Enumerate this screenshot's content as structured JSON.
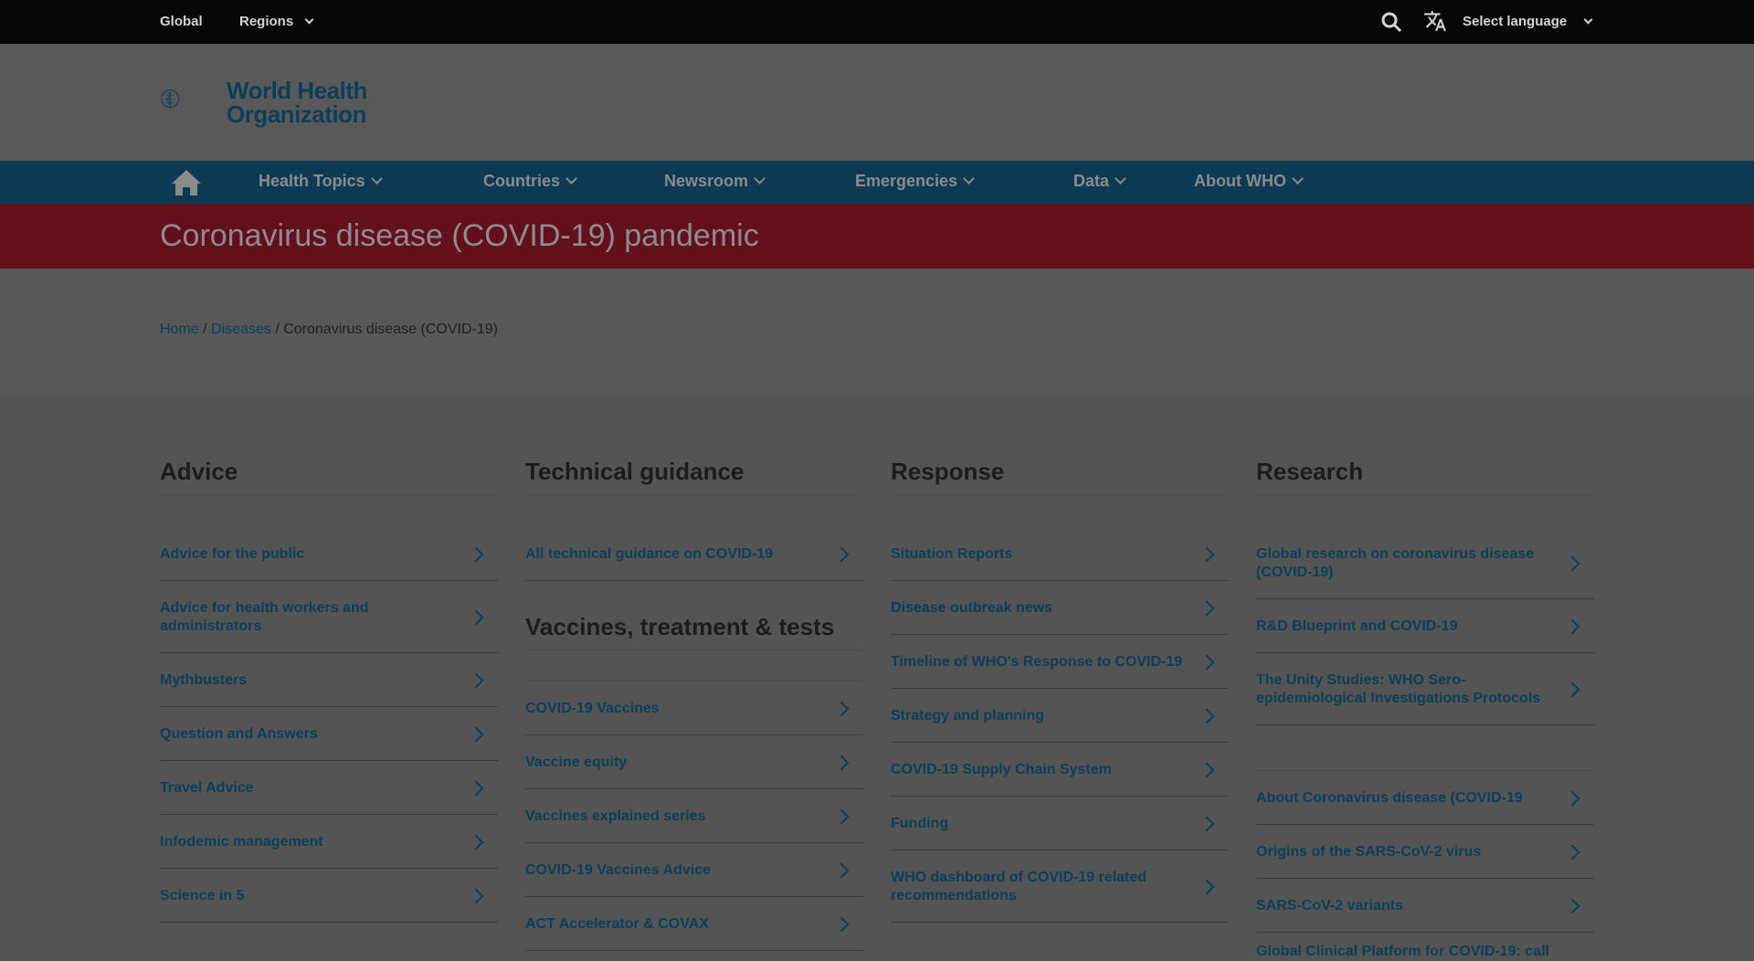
{
  "topbar": {
    "global": "Global",
    "regions": "Regions",
    "select_language": "Select language"
  },
  "logo": {
    "line1": "World Health",
    "line2": "Organization"
  },
  "nav": {
    "items": [
      "Health Topics",
      "Countries",
      "Newsroom",
      "Emergencies",
      "Data",
      "About WHO"
    ]
  },
  "banner": {
    "title": "Coronavirus disease (COVID-19) pandemic"
  },
  "breadcrumb": {
    "home": "Home",
    "sep": "/",
    "diseases": "Diseases",
    "current": "Coronavirus disease (COVID-19)"
  },
  "sections": {
    "advice": {
      "heading": "Advice",
      "links": [
        "Advice for the public",
        "Advice for health workers and administrators",
        "Mythbusters",
        "Question and Answers",
        "Travel Advice",
        "Infodemic management",
        "Science in 5"
      ]
    },
    "technical": {
      "heading": "Technical guidance",
      "links": [
        "All technical guidance on COVID-19"
      ]
    },
    "vaccines": {
      "heading": "Vaccines, treatment & tests",
      "links": [
        "COVID-19 Vaccines",
        "Vaccine equity",
        "Vaccines explained series",
        "COVID-19 Vaccines Advice",
        "ACT Accelerator & COVAX"
      ]
    },
    "response": {
      "heading": "Response",
      "links": [
        "Situation Reports",
        "Disease outbreak news",
        "Timeline of WHO's Response to COVID-19",
        "Strategy and planning",
        "COVID-19 Supply Chain System",
        "Funding",
        "WHO dashboard of COVID-19 related recommendations"
      ]
    },
    "research": {
      "heading": "Research",
      "links": [
        "Global research on coronavirus disease (COVID-19)",
        "R&D Blueprint and COVID-19",
        "The Unity Studies: WHO Sero-epidemiological Investigations Protocols"
      ]
    },
    "about": {
      "links": [
        "About Coronavirus disease (COVID-19",
        "Origins of the SARS-CoV-2 virus",
        "SARS-CoV-2 variants",
        "Global Clinical Platform for COVID-19: call"
      ]
    }
  },
  "colors": {
    "link": "#0b3e5b",
    "nav_bg": "#0c3a55",
    "banner_bg": "#640f1c",
    "topbar_bg": "#070707"
  }
}
